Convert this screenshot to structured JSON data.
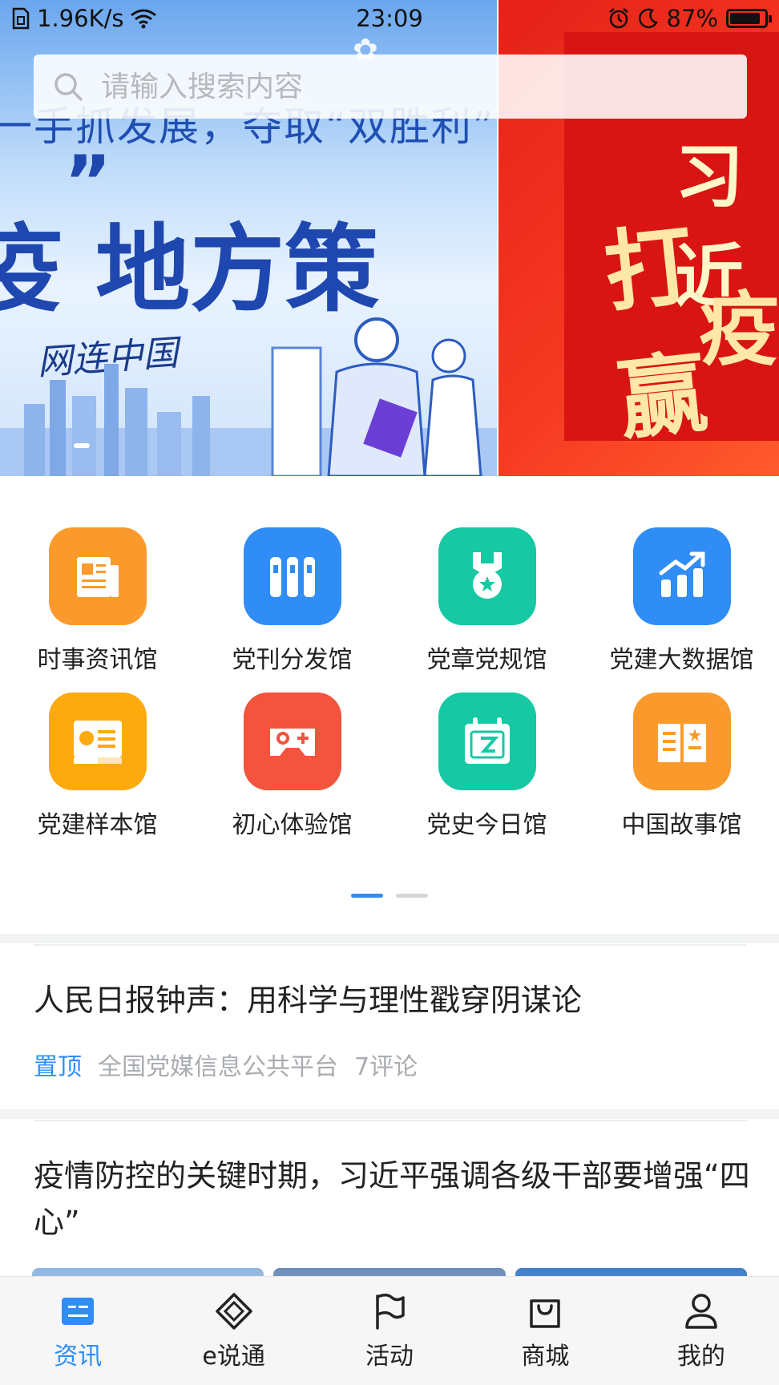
{
  "status_bar": {
    "speed": "1.96K/s",
    "time": "23:09",
    "battery": "87%",
    "battery_level": 0.87
  },
  "search": {
    "placeholder": "请输入搜索内容"
  },
  "banner": {
    "slide1": {
      "top_text": "一手抓发展，夺取“双胜利”",
      "main_text": "疫 地方策",
      "brand": "网连中国"
    },
    "slide2": {
      "line1": "习近",
      "line2": "打赢",
      "line3": "疫"
    }
  },
  "features": [
    {
      "label": "时事资讯馆",
      "icon": "newspaper-icon",
      "color": "#fb9a2c"
    },
    {
      "label": "党刊分发馆",
      "icon": "binders-icon",
      "color": "#2f8df5"
    },
    {
      "label": "党章党规馆",
      "icon": "medal-icon",
      "color": "#16c9a4"
    },
    {
      "label": "党建大数据馆",
      "icon": "chart-icon",
      "color": "#2f8df5"
    },
    {
      "label": "党建样本馆",
      "icon": "party-card-icon",
      "color": "#fdaa0f"
    },
    {
      "label": "初心体验馆",
      "icon": "gamepad-icon",
      "color": "#f2543d"
    },
    {
      "label": "党史今日馆",
      "icon": "calendar-icon",
      "color": "#16c9a4"
    },
    {
      "label": "中国故事馆",
      "icon": "book-icon",
      "color": "#fb9a2c"
    }
  ],
  "news": [
    {
      "title": "人民日报钟声：用科学与理性戳穿阴谋论",
      "tag": "置顶",
      "source": "全国党媒信息公共平台",
      "comments": "7评论"
    },
    {
      "title": "疫情防控的关键时期，习近平强调各级干部要增强“四心”"
    }
  ],
  "tabs": [
    {
      "label": "资讯",
      "icon": "news-tab-icon",
      "active": true
    },
    {
      "label": "e说通",
      "icon": "diamond-tab-icon"
    },
    {
      "label": "活动",
      "icon": "flag-tab-icon"
    },
    {
      "label": "商城",
      "icon": "bag-tab-icon"
    },
    {
      "label": "我的",
      "icon": "person-tab-icon"
    }
  ],
  "colors": {
    "accent": "#2f8df5"
  }
}
